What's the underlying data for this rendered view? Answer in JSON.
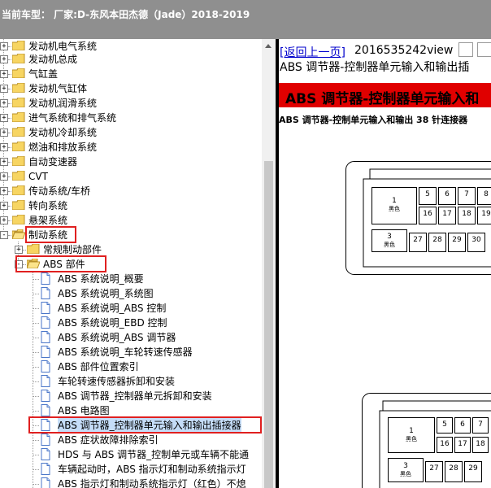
{
  "header": {
    "title": "当前车型：  厂家:D-东风本田杰德（Jade）2018-2019"
  },
  "tree": {
    "top_level": [
      {
        "label": "发动机电气系统",
        "expander": "+"
      },
      {
        "label": "发动机总成",
        "expander": "+"
      },
      {
        "label": "气缸盖",
        "expander": "+"
      },
      {
        "label": "发动机气缸体",
        "expander": "+"
      },
      {
        "label": "发动机润滑系统",
        "expander": "+"
      },
      {
        "label": "进气系统和排气系统",
        "expander": "+"
      },
      {
        "label": "发动机冷却系统",
        "expander": "+"
      },
      {
        "label": "燃油和排放系统",
        "expander": "+"
      },
      {
        "label": "自动变速器",
        "expander": "+"
      },
      {
        "label": "CVT",
        "expander": "+"
      },
      {
        "label": "传动系统/车桥",
        "expander": "+"
      },
      {
        "label": "转向系统",
        "expander": "+"
      },
      {
        "label": "悬架系统",
        "expander": "+"
      },
      {
        "label": "制动系统",
        "expander": "-"
      }
    ],
    "brake_children": [
      {
        "label": "常规制动部件",
        "expander": "+"
      },
      {
        "label": "ABS 部件",
        "expander": "-"
      }
    ],
    "abs_docs": [
      "ABS 系统说明_概要",
      "ABS 系统说明_系统图",
      "ABS 系统说明_ABS 控制",
      "ABS 系统说明_EBD 控制",
      "ABS 系统说明_ABS 调节器",
      "ABS 系统说明_车轮转速传感器",
      "ABS 部件位置索引",
      "车轮转速传感器拆卸和安装",
      "ABS 调节器_控制器单元拆卸和安装",
      "ABS 电路图",
      "ABS 调节器_控制器单元输入和输出插接器",
      "ABS 症状故障排除索引",
      "HDS 与 ABS 调节器_控制单元或车辆不能通",
      "车辆起动时，ABS 指示灯和制动系统指示灯",
      "ABS 指示灯和制动系统指示灯（红色）不熄"
    ]
  },
  "content": {
    "back_link": "[返回上一页]",
    "doc_id": "2016535242view",
    "title": "ABS 调节器-控制器单元输入和输出插",
    "banner": "ABS 调节器-控制器单元输入和",
    "subtitle": "ABS 调节器-控制单元输入和输出 38 针连接器",
    "connector1": {
      "cells": [
        {
          "n": "1",
          "c": "黑色"
        },
        {
          "n": "5",
          "c": ""
        },
        {
          "n": "6",
          "c": ""
        },
        {
          "n": "7",
          "c": ""
        },
        {
          "n": "8",
          "c": ""
        },
        {
          "n": "16",
          "c": ""
        },
        {
          "n": "17",
          "c": ""
        },
        {
          "n": "18",
          "c": ""
        },
        {
          "n": "19",
          "c": ""
        },
        {
          "n": "3",
          "c": "黑色"
        },
        {
          "n": "27",
          "c": ""
        },
        {
          "n": "28",
          "c": ""
        },
        {
          "n": "29",
          "c": ""
        },
        {
          "n": "30",
          "c": ""
        }
      ]
    },
    "connector2": {
      "cells": [
        {
          "n": "1",
          "c": "黑色"
        },
        {
          "n": "5",
          "c": ""
        },
        {
          "n": "6",
          "c": ""
        },
        {
          "n": "7",
          "c": ""
        },
        {
          "n": "16",
          "c": ""
        },
        {
          "n": "17",
          "c": ""
        },
        {
          "n": "18",
          "c": ""
        },
        {
          "n": "3",
          "c": "黑色"
        },
        {
          "n": "27",
          "c": ""
        },
        {
          "n": "28",
          "c": ""
        },
        {
          "n": "29",
          "c": ""
        }
      ]
    }
  },
  "colors": {
    "highlight": "#e02020",
    "banner": "#e00000",
    "link": "#0000cc",
    "header_bg": "#8f8f8f"
  }
}
